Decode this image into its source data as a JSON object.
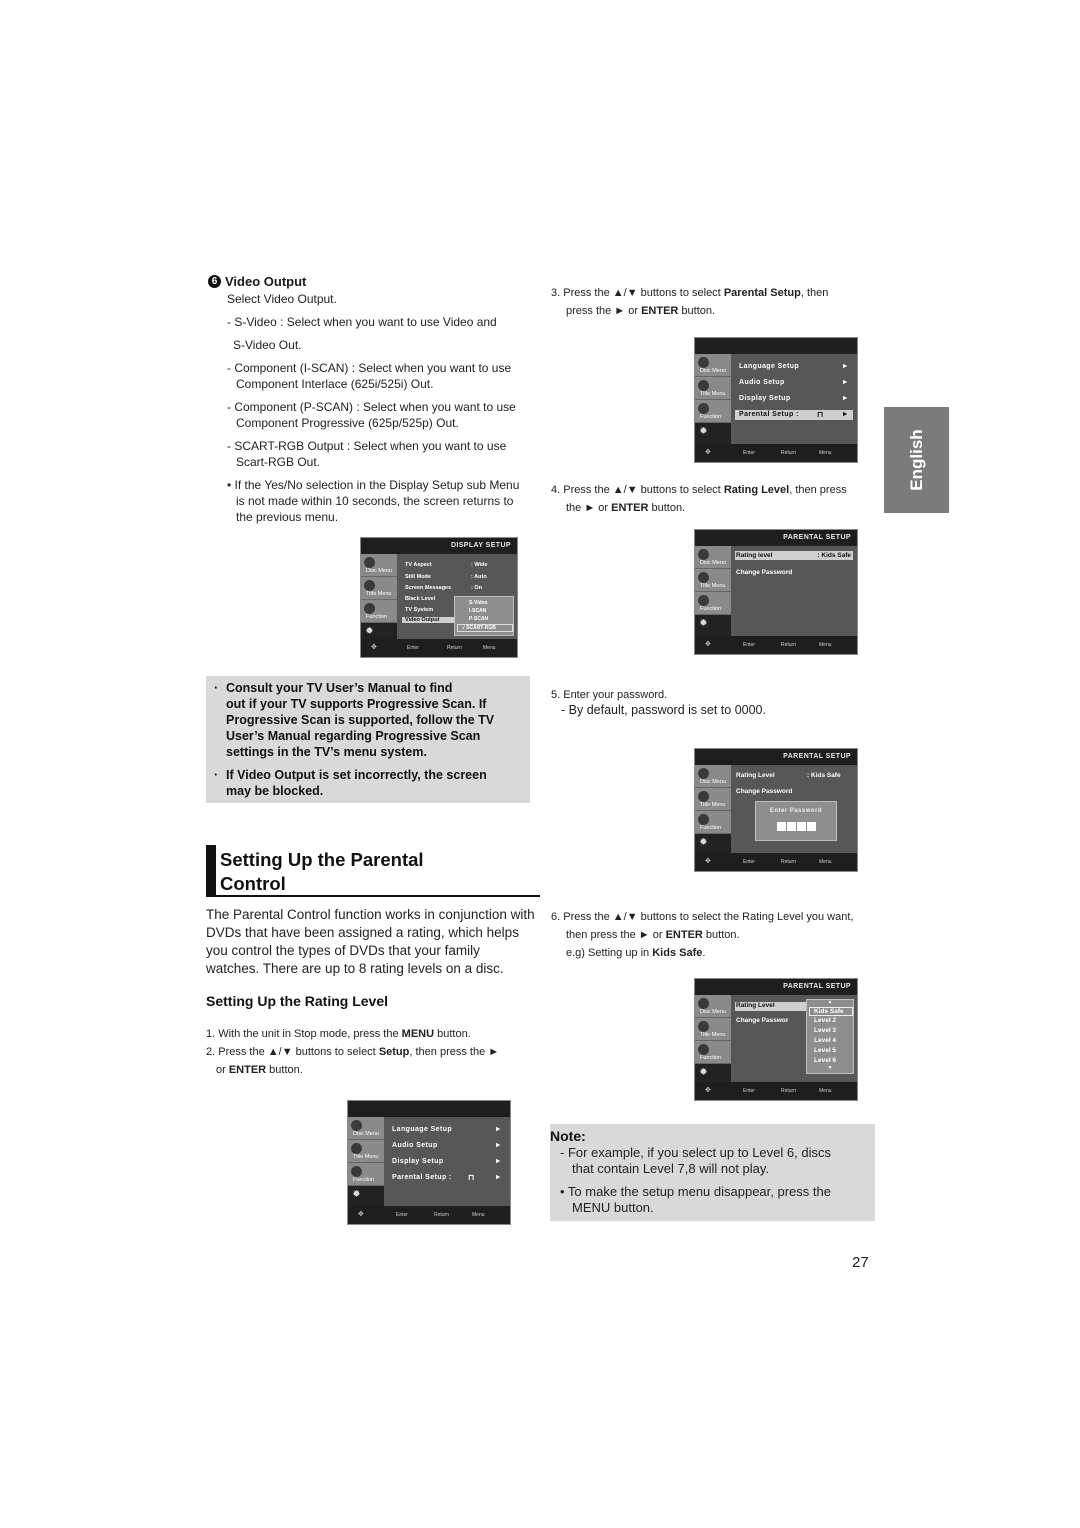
{
  "video_output": {
    "number": "6",
    "heading": "Video Output",
    "intro": "Select Video Output.",
    "items": [
      "- S-Video : Select when you want to use Video and",
      "S-Video Out.",
      "- Component (I-SCAN) : Select when you want to use",
      "Component Interlace (625i/525i) Out.",
      "- Component (P-SCAN) : Select when you want to use",
      "Component Progressive (625p/525p) Out.",
      "- SCART-RGB Output : Select when you want to use",
      "Scart-RGB Out."
    ],
    "bullet": [
      "• If the Yes/No selection in the Display Setup sub Menu",
      "is not made within 10 seconds, the screen returns to",
      "the previous menu."
    ]
  },
  "menu_common": {
    "tabs": [
      "Disc Menu",
      "Title Menu",
      "Function",
      "Setup"
    ],
    "footer": {
      "nav": "✥",
      "enter": "Enter",
      "return": "Return",
      "menu": "Menu"
    }
  },
  "display_setup_screen": {
    "title": "DISPLAY SETUP",
    "rows": [
      {
        "label": "TV Aspect",
        "value": ": Wide"
      },
      {
        "label": "Still Mode",
        "value": ": Auto"
      },
      {
        "label": "Screen Messages",
        "value": ": On"
      },
      {
        "label": "Black Level",
        "value": ""
      },
      {
        "label": "TV System",
        "value": ""
      },
      {
        "label": "Video Output",
        "value": ""
      }
    ],
    "options": [
      "S-Video",
      "I-SCAN",
      "P-SCAN",
      "√  SCART-RGB"
    ],
    "selected_option": "SCART-RGB"
  },
  "warning_box": {
    "bullets": [
      [
        "Consult your TV User’s Manual to find",
        "out if your TV supports Progressive Scan. If",
        "Progressive Scan is supported, follow the TV",
        "User’s Manual regarding Progressive Scan",
        "settings in the TV’s menu system."
      ],
      [
        "If Video Output is set incorrectly, the screen",
        "may be blocked."
      ]
    ]
  },
  "parental_section": {
    "title_line1": "Setting Up the Parental",
    "title_line2": "Control",
    "paragraph": "The Parental Control function works in conjunction with DVDs that have been assigned a rating, which helps you control the types of DVDs that your family watches. There are up to 8 rating levels on a disc.",
    "subtitle": "Setting Up the Rating Level",
    "step1": {
      "pre": "1. With the unit in Stop mode, press the ",
      "bold": "MENU",
      "post": " button."
    },
    "step2": {
      "l1_pre": "2. Press the ▲/▼ buttons to select ",
      "l1_bold": "Setup",
      "l1_post": ", then press the ►",
      "l2_pre": "or ",
      "l2_bold": "ENTER",
      "l2_post": " button."
    }
  },
  "setup_menu_screen": {
    "rows": [
      "Language Setup",
      "Audio Setup",
      "Display Setup",
      "Parental Setup :"
    ],
    "arrow": "►"
  },
  "steps_right": {
    "step3": {
      "a": "3. Press the ▲/▼ buttons to select ",
      "b": "Parental Setup",
      "c": ", then",
      "d": "press the ► or ",
      "e": "ENTER",
      "f": " button."
    },
    "step4": {
      "a": "4. Press the ▲/▼ buttons to select ",
      "b": "Rating Level",
      "c": ", then press",
      "d": "the ► or ",
      "e": "ENTER",
      "f": " button."
    },
    "step5": {
      "a": "5. Enter your password.",
      "b": "- By default, password is set to 0000."
    },
    "step6": {
      "a": "6. Press the ▲/▼ buttons to select the Rating Level you want,",
      "b": "then press the ► or ",
      "c": "ENTER",
      "d": " button.",
      "e": "e.g) Setting up in ",
      "f": "Kids Safe",
      "g": "."
    }
  },
  "parental_screen_1": {
    "title": "PARENTAL SETUP",
    "rating_label": "Rating level",
    "rating_value": ": Kids Safe",
    "change_password": "Change Password"
  },
  "parental_screen_2": {
    "title": "PARENTAL SETUP",
    "rating_label": "Rating Level",
    "rating_value": ": Kids Safe",
    "change_password": "Change Password",
    "dialog_title": "Enter Password"
  },
  "parental_screen_3": {
    "title": "PARENTAL SETUP",
    "rating_label": "Rating Level",
    "change_password": "Change Passwor",
    "levels": [
      "Kids Safe",
      "Level 2",
      "Level 3",
      "Level 4",
      "Level 5",
      "Level 6"
    ],
    "selected": "Kids Safe",
    "up": "▲",
    "down": "▼"
  },
  "language_tab": "English",
  "note": {
    "heading": "Note:",
    "line1": "-  For example, if you select up to Level 6, discs",
    "line2": "that contain Level 7,8 will not play.",
    "line3": "• To make the setup menu disappear, press the",
    "line4": "MENU button."
  },
  "page_number": "27"
}
